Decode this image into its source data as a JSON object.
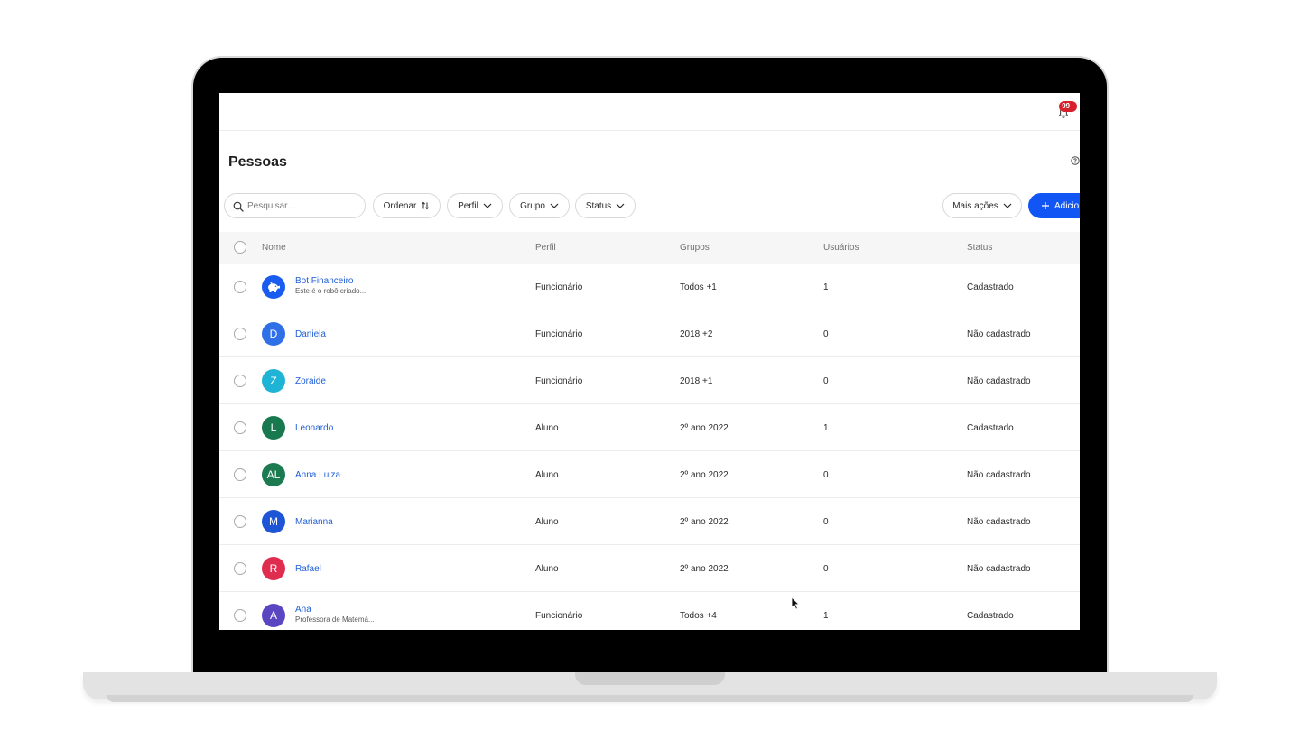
{
  "header": {
    "notification_badge": "99+"
  },
  "page": {
    "title": "Pessoas"
  },
  "toolbar": {
    "search_placeholder": "Pesquisar...",
    "sort_label": "Ordenar",
    "filters": [
      "Perfil",
      "Grupo",
      "Status"
    ],
    "more_actions_label": "Mais ações",
    "add_label": "Adicio"
  },
  "table": {
    "columns": [
      "Nome",
      "Perfil",
      "Grupos",
      "Usuários",
      "Status"
    ],
    "rows": [
      {
        "initials": "",
        "avatar_icon": "piggy-bank-icon",
        "avatar_color": "#1a5cf0",
        "name": "Bot Financeiro",
        "subtitle": "Este é o robô criado...",
        "perfil": "Funcionário",
        "grupos": "Todos +1",
        "usuarios": "1",
        "status": "Cadastrado"
      },
      {
        "initials": "D",
        "avatar_color": "#2f6fe8",
        "name": "Daniela",
        "subtitle": "",
        "perfil": "Funcionário",
        "grupos": "2018 +2",
        "usuarios": "0",
        "status": "Não cadastrado"
      },
      {
        "initials": "Z",
        "avatar_color": "#1fb3d6",
        "name": "Zoraide",
        "subtitle": "",
        "perfil": "Funcionário",
        "grupos": "2018 +1",
        "usuarios": "0",
        "status": "Não cadastrado"
      },
      {
        "initials": "L",
        "avatar_color": "#18794e",
        "name": "Leonardo",
        "subtitle": "",
        "perfil": "Aluno",
        "grupos": "2º ano 2022",
        "usuarios": "1",
        "status": "Cadastrado"
      },
      {
        "initials": "AL",
        "avatar_color": "#1b7a4f",
        "name": "Anna Luiza",
        "subtitle": "",
        "perfil": "Aluno",
        "grupos": "2º ano 2022",
        "usuarios": "0",
        "status": "Não cadastrado"
      },
      {
        "initials": "M",
        "avatar_color": "#1d55d6",
        "name": "Marianna",
        "subtitle": "",
        "perfil": "Aluno",
        "grupos": "2º ano 2022",
        "usuarios": "0",
        "status": "Não cadastrado"
      },
      {
        "initials": "R",
        "avatar_color": "#e02d4f",
        "name": "Rafael",
        "subtitle": "",
        "perfil": "Aluno",
        "grupos": "2º ano 2022",
        "usuarios": "0",
        "status": "Não cadastrado"
      },
      {
        "initials": "A",
        "avatar_color": "#5b46c2",
        "name": "Ana",
        "subtitle": "Professora de Matemá...",
        "perfil": "Funcionário",
        "grupos": "Todos +4",
        "usuarios": "1",
        "status": "Cadastrado"
      }
    ]
  },
  "colors": {
    "primary": "#1156f5",
    "link": "#1f5ed8",
    "badge": "#d6212c"
  }
}
